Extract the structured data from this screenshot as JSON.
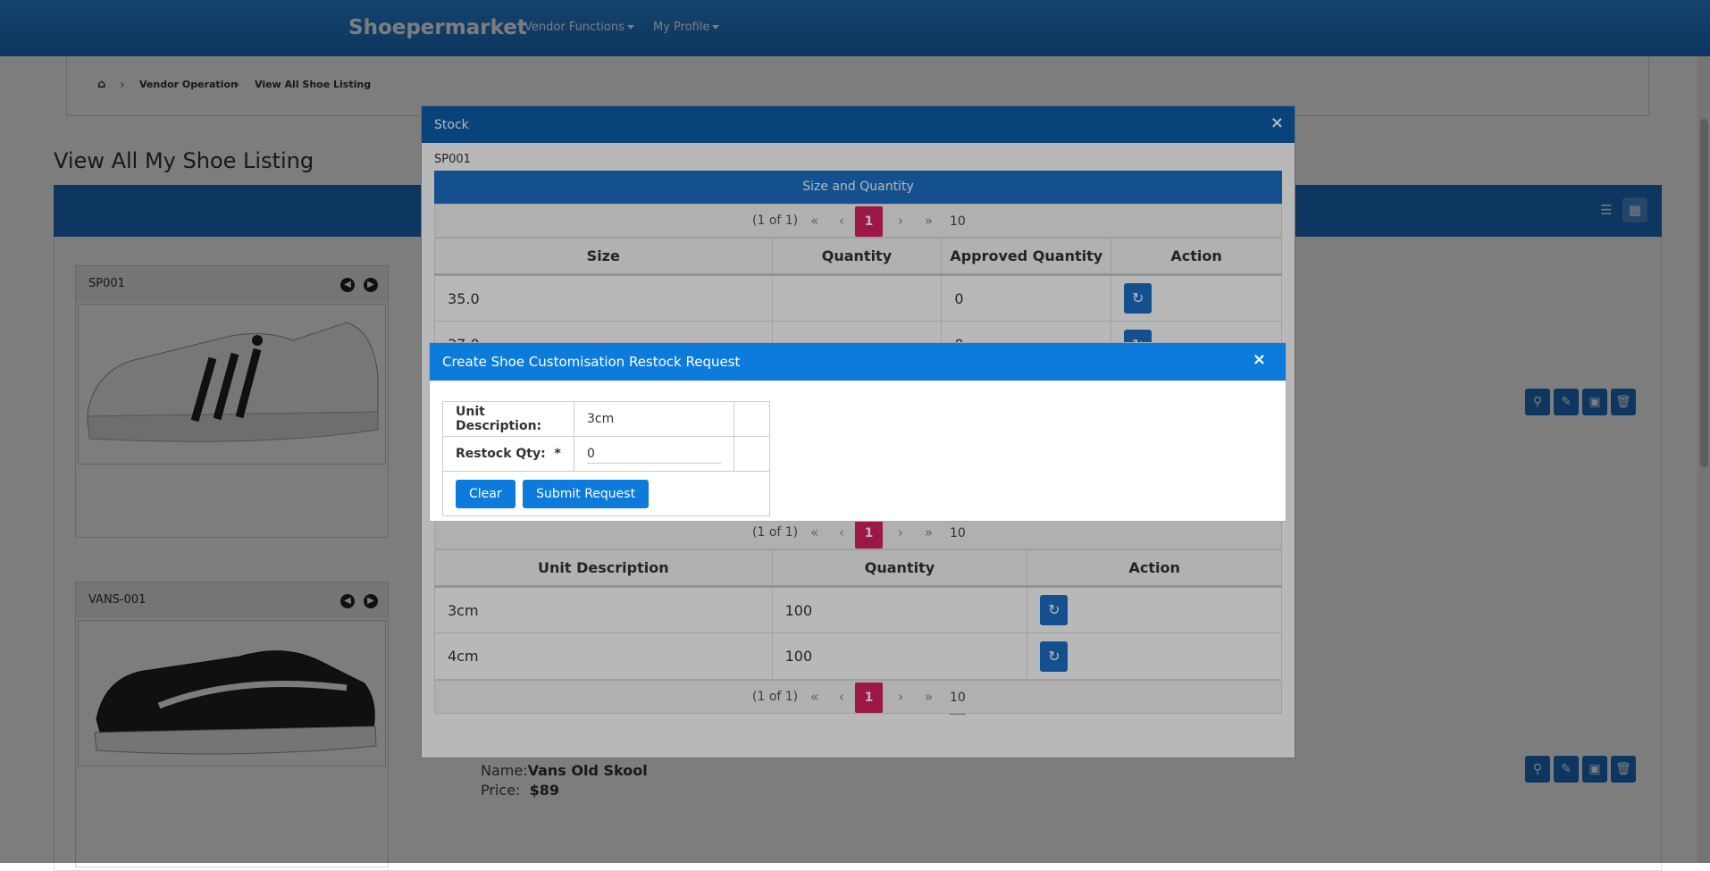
{
  "app": {
    "brand": "Shoepermarket",
    "nav": [
      "Vendor Functions",
      "My Profile"
    ]
  },
  "breadcrumb": [
    "Vendor Operation",
    "View All Shoe Listing"
  ],
  "page": {
    "title": "View All My Shoe Listing"
  },
  "products": [
    {
      "code": "SP001",
      "name_label": "",
      "name": "",
      "price_label": "",
      "price": ""
    },
    {
      "code": "VANS-001",
      "name_label": "Name:",
      "name": "Vans Old Skool",
      "price_label": "Price:",
      "price": "$89"
    }
  ],
  "stock_dialog": {
    "title": "Stock",
    "close": "×",
    "code": "SP001",
    "size_table": {
      "caption": "Size and Quantity",
      "headers": [
        "Size",
        "Quantity",
        "Approved Quantity",
        "Action"
      ],
      "rows": [
        {
          "size": "35.0",
          "quantity": "",
          "approved": "0"
        },
        {
          "size": "37.0",
          "quantity": "",
          "approved": "0"
        }
      ]
    },
    "unit_table": {
      "headers": [
        "Unit Description",
        "Quantity",
        "Action"
      ],
      "rows": [
        {
          "unit": "3cm",
          "quantity": "100"
        },
        {
          "unit": "4cm",
          "quantity": "100"
        }
      ]
    },
    "pager": {
      "report": "(1 of 1)",
      "first": "«",
      "prev": "‹",
      "page": "1",
      "next": "›",
      "last": "»",
      "rows_per_page": "10"
    }
  },
  "restock_dialog": {
    "title": "Create Shoe Customisation Restock Request",
    "close": "×",
    "unit_label": "Unit Description:",
    "unit_value": "3cm",
    "qty_label": "Restock Qty:",
    "qty_required": "*",
    "qty_value": "0",
    "clear_button": "Clear",
    "submit_button": "Submit Request"
  },
  "colors": {
    "header_blue": "#1b6fc4",
    "dialog_blue": "#0c5eaa",
    "restock_blue": "#0c7bdc",
    "active_page": "#d81f63"
  }
}
